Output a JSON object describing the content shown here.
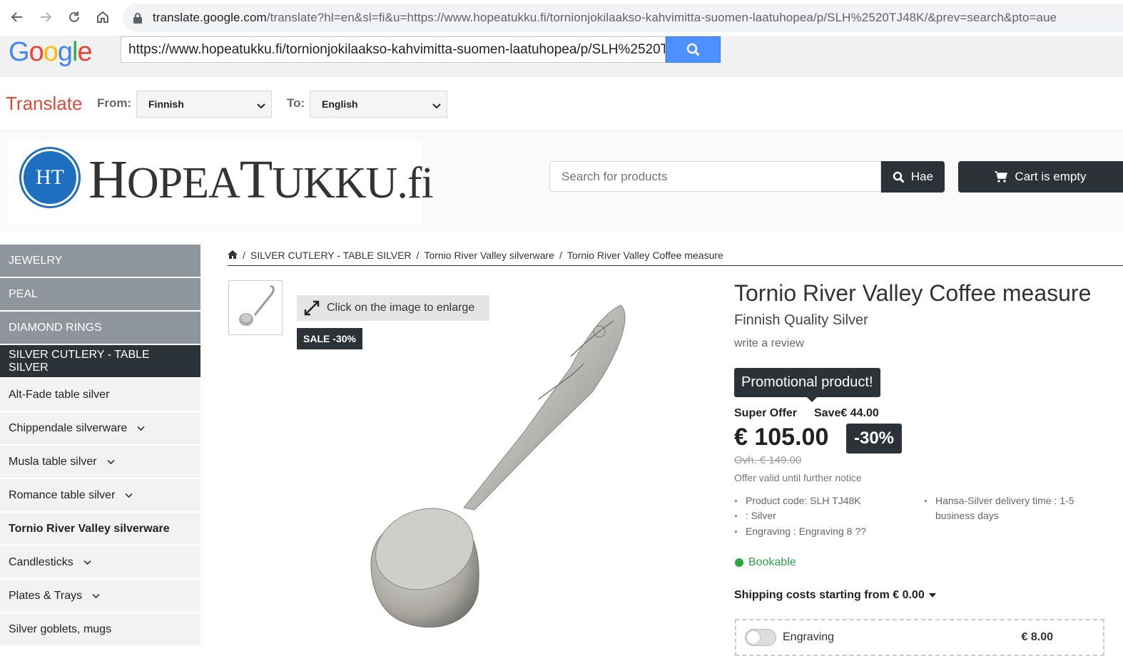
{
  "browser": {
    "url_host": "translate.google.com",
    "url_path": "/translate?hl=en&sl=fi&u=https://www.hopeatukku.fi/tornionjokilaakso-kahvimitta-suomen-laatuhopea/p/SLH%2520TJ48K/&prev=search&pto=aue"
  },
  "google_bar": {
    "logo_letters": [
      "G",
      "o",
      "o",
      "g",
      "l",
      "e"
    ],
    "logo_colors": [
      "#4285f4",
      "#ea4335",
      "#fbbc05",
      "#4285f4",
      "#34a853",
      "#ea4335"
    ],
    "search_value": "https://www.hopeatukku.fi/tornionjokilaakso-kahvimitta-suomen-laatuhopea/p/SLH%2520TJ48K/"
  },
  "translate_bar": {
    "title": "Translate",
    "from_label": "From:",
    "from_value": "Finnish",
    "to_label": "To:",
    "to_value": "English"
  },
  "site": {
    "logo_badge": "HT",
    "logo_parts": [
      "H",
      "OPEA",
      "T",
      "UKKU",
      ".fi"
    ],
    "search_placeholder": "Search for products",
    "search_button": "Hae",
    "cart_label": "Cart is empty",
    "accent": "#2c3338"
  },
  "sidebar": {
    "items": [
      {
        "label": "JEWELRY",
        "style": "top"
      },
      {
        "label": "PEAL",
        "style": "top"
      },
      {
        "label": "DIAMOND RINGS",
        "style": "top"
      },
      {
        "label": "SILVER CUTLERY - TABLE SILVER",
        "style": "active"
      },
      {
        "label": "Alt-Fade table silver",
        "style": "sub"
      },
      {
        "label": "Chippendale silverware",
        "style": "sub",
        "expand": true
      },
      {
        "label": "Musla table silver",
        "style": "sub",
        "expand": true
      },
      {
        "label": "Romance table silver",
        "style": "sub",
        "expand": true
      },
      {
        "label": "Tornio River Valley silverware",
        "style": "sub-bold"
      },
      {
        "label": "Candlesticks",
        "style": "sub",
        "expand": true
      },
      {
        "label": "Plates & Trays",
        "style": "sub",
        "expand": true
      },
      {
        "label": "Silver goblets, mugs",
        "style": "sub"
      }
    ]
  },
  "breadcrumb": {
    "items": [
      "SILVER CUTLERY - TABLE SILVER",
      "Tornio River Valley silverware",
      "Tornio River Valley Coffee measure"
    ]
  },
  "gallery": {
    "enlarge_text": "Click on the image to enlarge",
    "sale_badge": "SALE -30%"
  },
  "product": {
    "title": "Tornio River Valley Coffee measure",
    "subtitle": "Finnish Quality Silver",
    "review_link": "write a review",
    "promo": "Promotional product!",
    "offer_label": "Super Offer",
    "save_text": "Save€ 44.00",
    "price": "€ 105.00",
    "discount": "-30%",
    "old_price": "Ovh. € 149.00",
    "valid": "Offer valid until further notice",
    "specs": [
      "Product code: SLH TJ48K",
      ": Silver",
      "Engraving : Engraving 8 ??",
      "Hansa-Silver delivery time : 1-5",
      "business days"
    ],
    "availability": "Bookable",
    "shipping": "Shipping costs starting from € 0.00",
    "engraving_label": "Engraving",
    "engraving_price": "€ 8.00"
  }
}
